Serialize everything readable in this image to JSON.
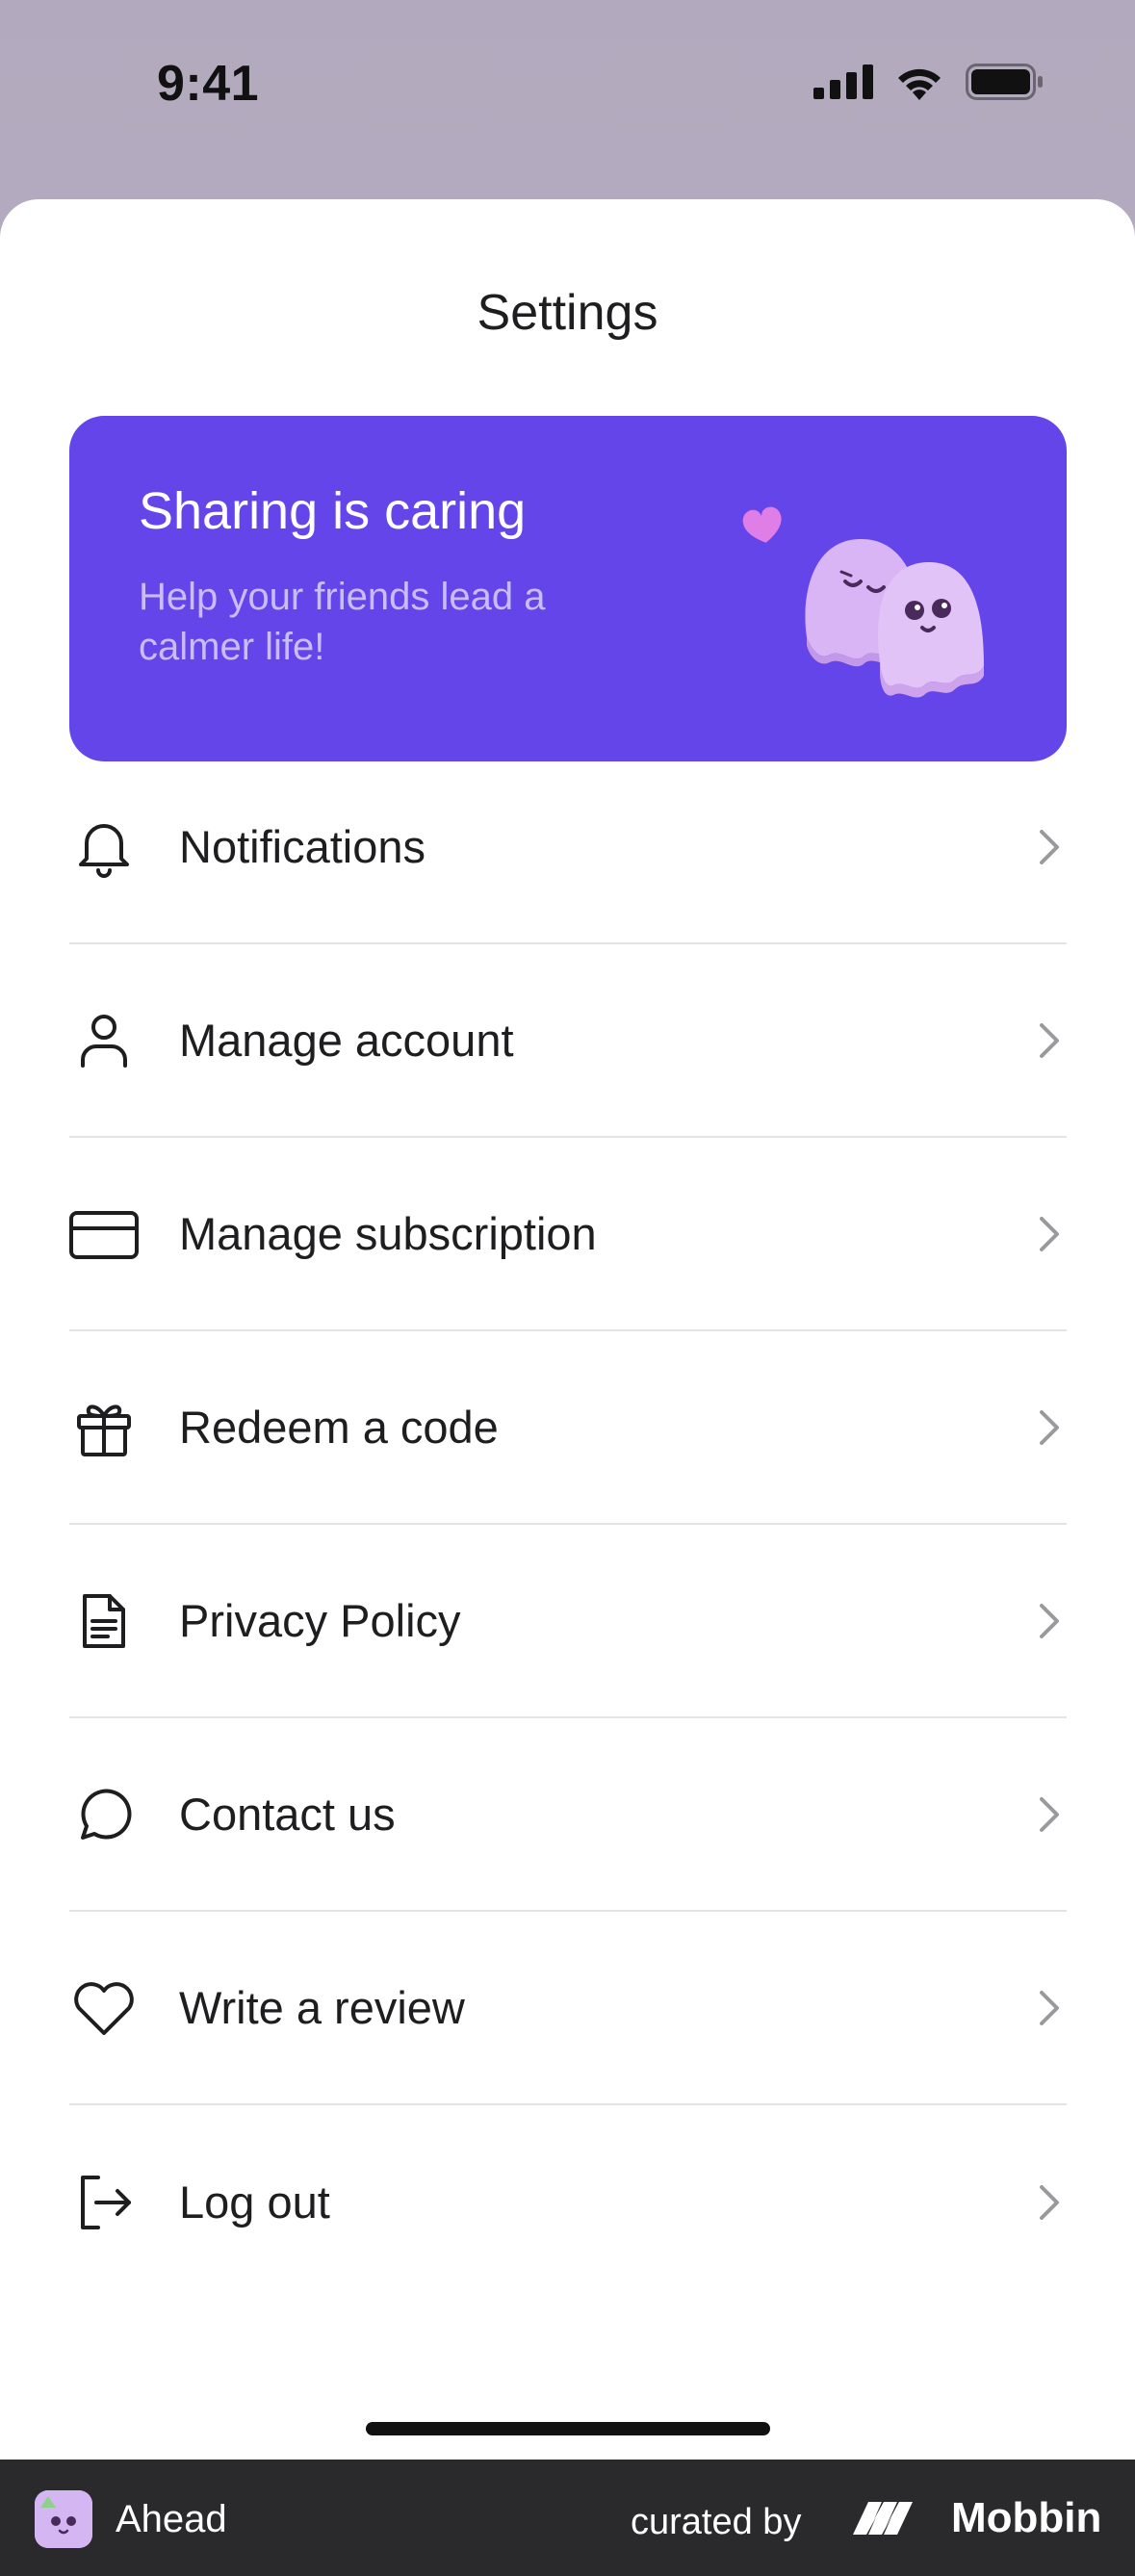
{
  "status_bar": {
    "time": "9:41",
    "icons": [
      "cellular-signal-icon",
      "wifi-icon",
      "battery-icon"
    ]
  },
  "sheet": {
    "title": "Settings"
  },
  "promo": {
    "title": "Sharing is caring",
    "subtitle": "Help your friends lead a calmer life!",
    "background": "#6345ea",
    "illustration": "ghosts-illustration"
  },
  "menu": {
    "items": [
      {
        "label": "Notifications",
        "icon": "bell-icon"
      },
      {
        "label": "Manage account",
        "icon": "person-icon"
      },
      {
        "label": "Manage subscription",
        "icon": "credit-card-icon"
      },
      {
        "label": "Redeem a code",
        "icon": "gift-icon"
      },
      {
        "label": "Privacy Policy",
        "icon": "document-icon"
      },
      {
        "label": "Contact us",
        "icon": "chat-bubble-icon"
      },
      {
        "label": "Write a review",
        "icon": "heart-icon"
      },
      {
        "label": "Log out",
        "icon": "logout-icon"
      }
    ]
  },
  "footer": {
    "app_name": "Ahead",
    "curated_by": "curated by",
    "brand": "Mobbin"
  },
  "colors": {
    "accent": "#6345ea",
    "text": "#1e1e20",
    "divider": "#e4e4e6",
    "chevron": "#9a9a9e"
  }
}
